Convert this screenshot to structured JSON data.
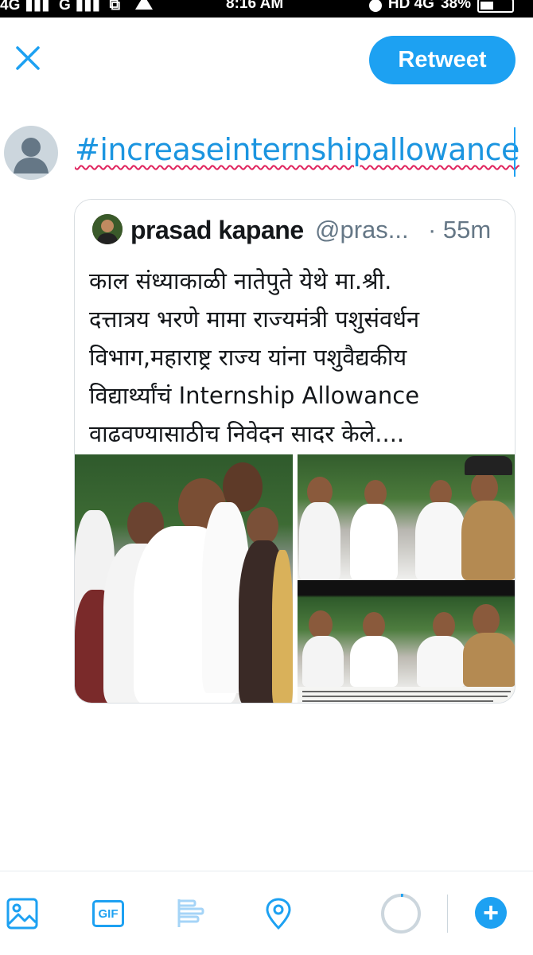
{
  "status_bar": {
    "left_text": "4G",
    "left_signal_1": "G",
    "time": "8:16 AM",
    "right_text": "HD 4G",
    "battery": "38%"
  },
  "header": {
    "retweet_label": "Retweet"
  },
  "compose": {
    "text": "#increaseinternshipallowance"
  },
  "quoted_tweet": {
    "name": "prasad kapane",
    "handle": "@pras...",
    "time": "· 55m",
    "text": "काल संध्याकाळी नातेपुते येथे मा.श्री.\nदत्तात्रय भरणे मामा राज्यमंत्री पशुसंवर्धन\nविभाग,महाराष्ट्र राज्य यांना पशुवैद्यकीय\nविद्यार्थ्यांचं Internship Allowance\nवाढवण्यासाठीच निवेदन सादर केले....",
    "photo_count": 3
  },
  "toolbar": {
    "icons": [
      "image-icon",
      "gif-icon",
      "poll-icon",
      "location-icon"
    ],
    "gif_label": "GIF",
    "character_progress": 0.02,
    "add_label": "+"
  },
  "colors": {
    "accent": "#1da1f2",
    "hashtag": "#1b95e0",
    "spellcheck": "#e0245e",
    "secondary_text": "#657786"
  }
}
